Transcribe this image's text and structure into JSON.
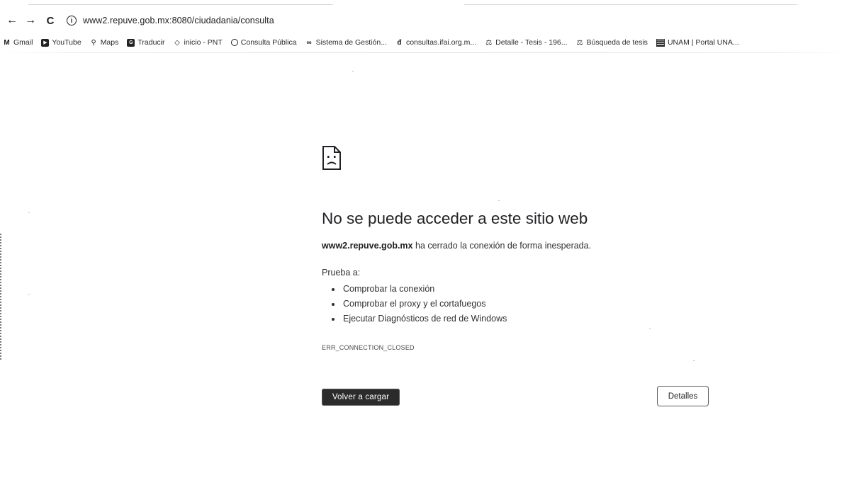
{
  "browser": {
    "url": "www2.repuve.gob.mx:8080/ciudadania/consulta",
    "nav": {
      "back": "←",
      "forward": "→",
      "reload": "C",
      "info": "i"
    }
  },
  "bookmarks": [
    {
      "label": "Gmail",
      "icon": "gmail-icon",
      "glyph": "M"
    },
    {
      "label": "YouTube",
      "icon": "youtube-icon",
      "glyph": "▶"
    },
    {
      "label": "Maps",
      "icon": "maps-icon",
      "glyph": "⚲"
    },
    {
      "label": "Traducir",
      "icon": "translate-icon",
      "glyph": "G"
    },
    {
      "label": "inicio - PNT",
      "icon": "pnt-icon",
      "glyph": "◇"
    },
    {
      "label": "Consulta Pública",
      "icon": "globe-icon",
      "glyph": "⊙"
    },
    {
      "label": "Sistema de Gestión...",
      "icon": "link-icon",
      "glyph": "∞"
    },
    {
      "label": "consultas.ifai.org.m...",
      "icon": "document-icon",
      "glyph": "đ"
    },
    {
      "label": "Detalle - Tesis - 196...",
      "icon": "scjn-icon",
      "glyph": "⚖"
    },
    {
      "label": "Búsqueda de tesis",
      "icon": "scjn-icon",
      "glyph": "⚖"
    },
    {
      "label": "UNAM | Portal UNA...",
      "icon": "unam-icon",
      "glyph": "▦"
    }
  ],
  "error": {
    "title": "No se puede acceder a este sitio web",
    "host": "www2.repuve.gob.mx",
    "message": " ha cerrado la conexión de forma inesperada.",
    "try_label": "Prueba a:",
    "suggestions": [
      "Comprobar la conexión",
      "Comprobar el proxy y el cortafuegos",
      "Ejecutar Diagnósticos de red de Windows"
    ],
    "code": "ERR_CONNECTION_CLOSED",
    "reload_button": "Volver a cargar",
    "details_button": "Detalles"
  }
}
